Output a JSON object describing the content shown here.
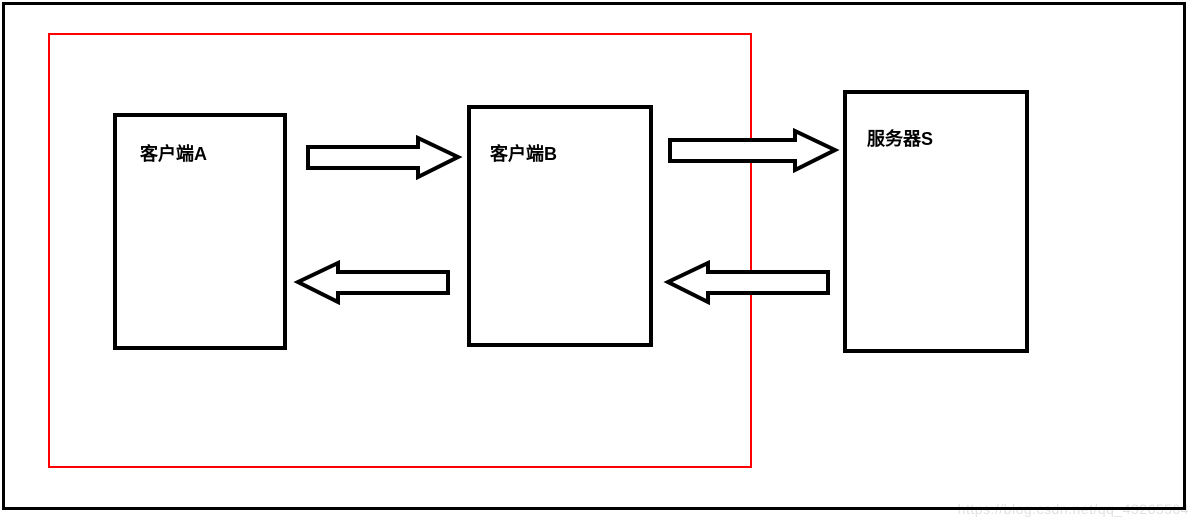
{
  "nodes": {
    "clientA": {
      "label": "客户端A"
    },
    "clientB": {
      "label": "客户端B"
    },
    "serverS": {
      "label": "服务器S"
    }
  },
  "watermark": "https://blog.csdn.net/qq_43265564"
}
